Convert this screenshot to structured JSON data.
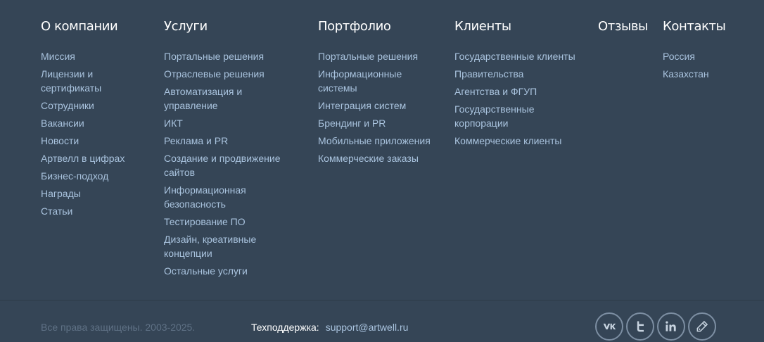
{
  "columns": [
    {
      "title": "О компании",
      "items": [
        "Миссия",
        "Лицензии и сертификаты",
        "Сотрудники",
        "Вакансии",
        "Новости",
        "Артвелл в цифрах",
        "Бизнес-подход",
        "Награды",
        "Статьи"
      ]
    },
    {
      "title": "Услуги",
      "items": [
        "Портальные решения",
        "Отраслевые решения",
        "Автоматизация и управление",
        "ИКТ",
        "Реклама и PR",
        "Создание и продвижение сайтов",
        "Информационная безопасность",
        "Тестирование ПО",
        "Дизайн, креативные концепции",
        "Остальные услуги"
      ]
    },
    {
      "title": "Портфолио",
      "items": [
        "Портальные решения",
        "Информационные системы",
        "Интеграция систем",
        "Брендинг и PR",
        "Мобильные приложения",
        "Коммерческие заказы"
      ]
    },
    {
      "title": "Клиенты",
      "items": [
        "Государственные клиенты",
        "Правительства",
        "Агентства и ФГУП",
        "Государственные корпорации",
        "Коммерческие клиенты"
      ]
    },
    {
      "title": "Отзывы",
      "items": []
    },
    {
      "title": "Контакты",
      "items": [
        "Россия",
        "Казахстан"
      ]
    }
  ],
  "footer": {
    "copyright": "Все права защищены. 2003-2025.",
    "support_label": "Техподдержка:",
    "support_email": "support@artwell.ru",
    "socials": [
      {
        "icon": "vk-icon"
      },
      {
        "icon": "twitter-icon"
      },
      {
        "icon": "linkedin-icon"
      },
      {
        "icon": "pencil-icon"
      }
    ]
  },
  "colors": {
    "background": "#354556",
    "link": "#a9c3de",
    "heading": "#ffffff",
    "muted": "#5f7185"
  }
}
